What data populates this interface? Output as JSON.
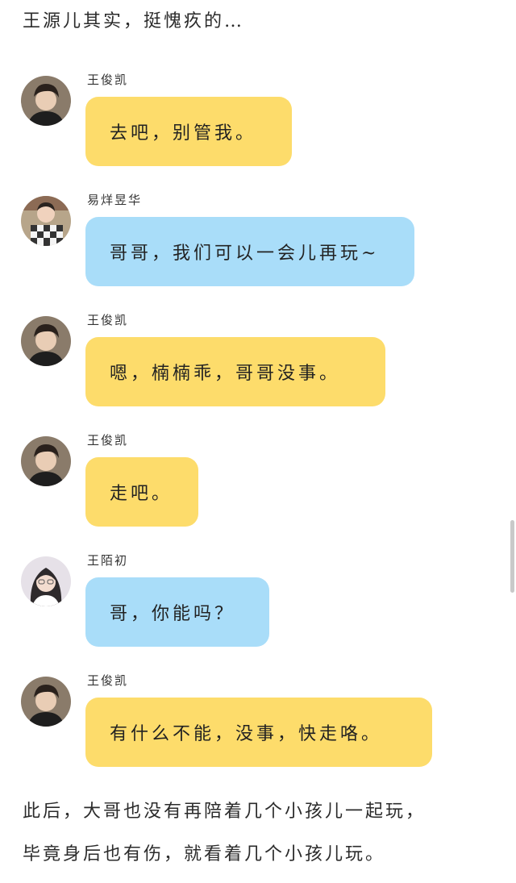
{
  "intro_text": "王源儿其实，挺愧疚的…",
  "messages": [
    {
      "sender": "王俊凯",
      "text": "去吧，别管我。",
      "bubble_color": "#fddc6b",
      "avatar": "boy-avatar-icon"
    },
    {
      "sender": "易烊昱华",
      "text": "哥哥，我们可以一会儿再玩~",
      "bubble_color": "#a9ddf9",
      "avatar": "child-avatar-icon"
    },
    {
      "sender": "王俊凯",
      "text": "嗯，楠楠乖，哥哥没事。",
      "bubble_color": "#fddc6b",
      "avatar": "boy-avatar-icon"
    },
    {
      "sender": "王俊凯",
      "text": "走吧。",
      "bubble_color": "#fddc6b",
      "avatar": "boy-avatar-icon"
    },
    {
      "sender": "王陌初",
      "text": "哥，你能吗？",
      "bubble_color": "#a9ddf9",
      "avatar": "girl-avatar-icon"
    },
    {
      "sender": "王俊凯",
      "text": "有什么不能，没事，快走咯。",
      "bubble_color": "#fddc6b",
      "avatar": "boy-avatar-icon"
    }
  ],
  "outro_lines": [
    "此后，大哥也没有再陪着几个小孩儿一起玩，",
    "毕竟身后也有伤，就看着几个小孩儿玩。"
  ]
}
